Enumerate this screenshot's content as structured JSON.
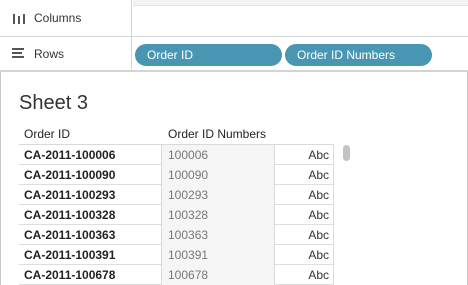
{
  "shelves": {
    "columns": {
      "label": "Columns",
      "icon": "columns-icon"
    },
    "rows": {
      "label": "Rows",
      "icon": "rows-icon",
      "pills": [
        "Order ID",
        "Order ID Numbers"
      ]
    }
  },
  "colors": {
    "pill": "#4996b2"
  },
  "sheet": {
    "title": "Sheet 3",
    "columns": [
      "Order ID",
      "Order ID Numbers"
    ],
    "rows": [
      {
        "order_id": "CA-2011-100006",
        "number": "100006",
        "value": "Abc"
      },
      {
        "order_id": "CA-2011-100090",
        "number": "100090",
        "value": "Abc"
      },
      {
        "order_id": "CA-2011-100293",
        "number": "100293",
        "value": "Abc"
      },
      {
        "order_id": "CA-2011-100328",
        "number": "100328",
        "value": "Abc"
      },
      {
        "order_id": "CA-2011-100363",
        "number": "100363",
        "value": "Abc"
      },
      {
        "order_id": "CA-2011-100391",
        "number": "100391",
        "value": "Abc"
      },
      {
        "order_id": "CA-2011-100678",
        "number": "100678",
        "value": "Abc"
      }
    ]
  }
}
